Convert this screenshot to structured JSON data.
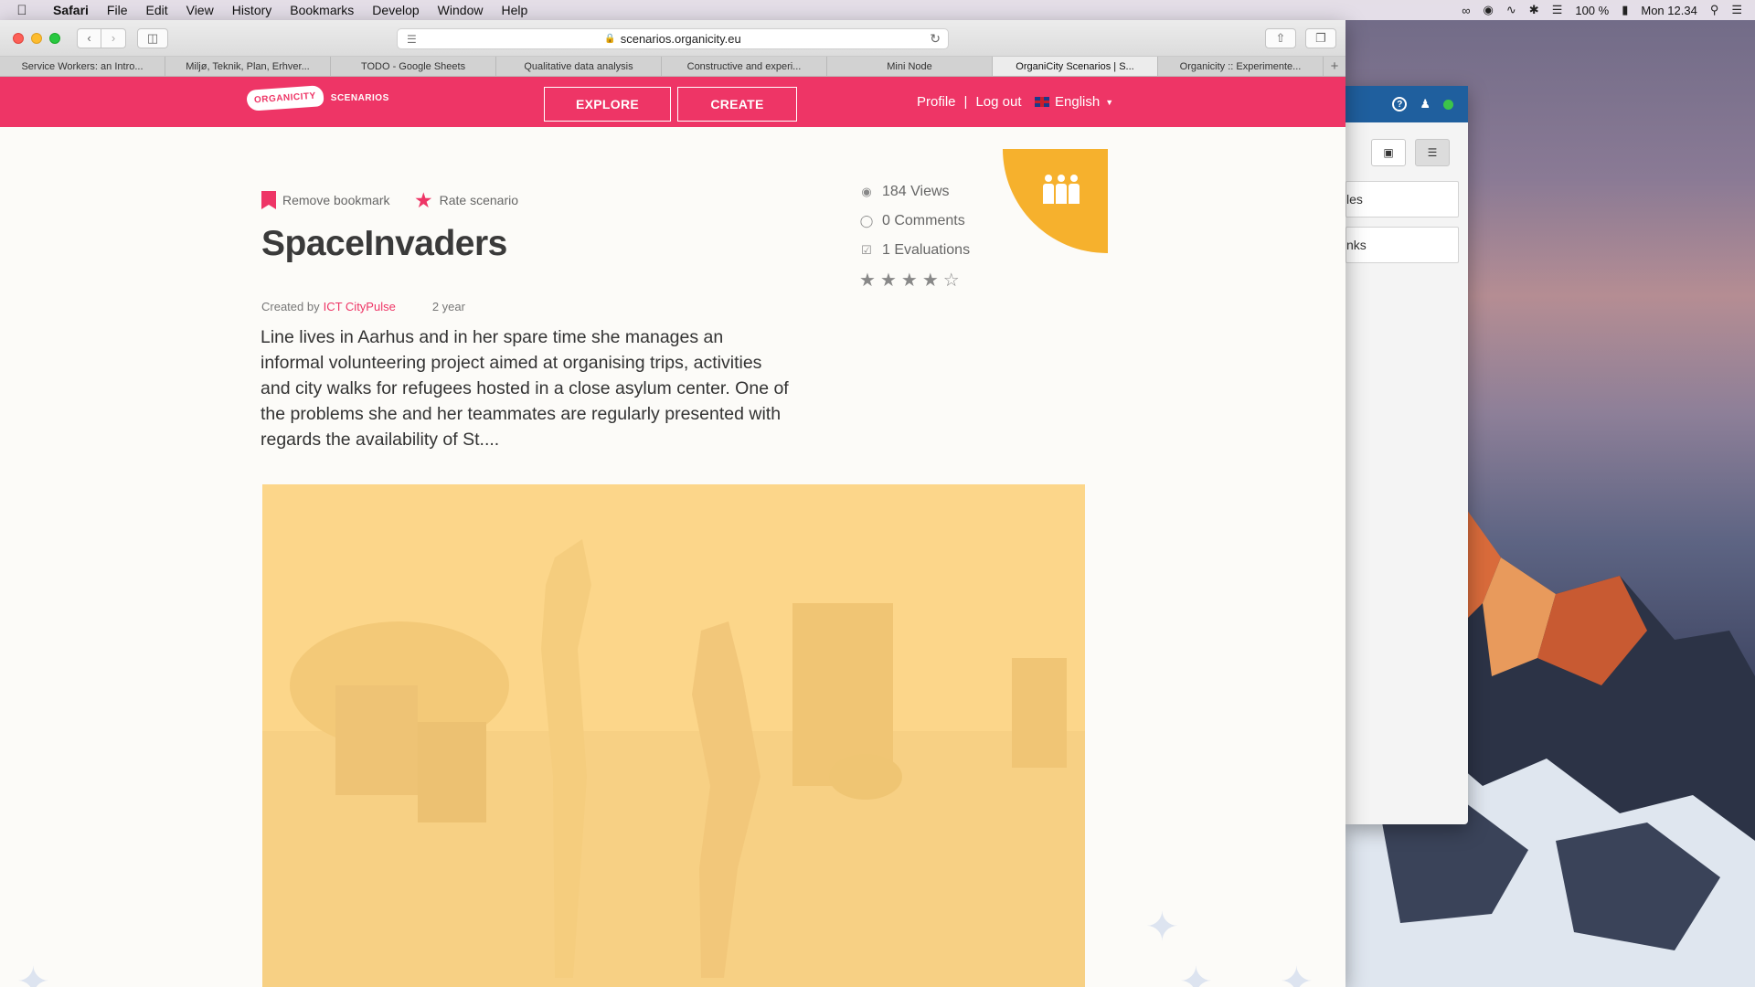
{
  "menubar": {
    "app": "Safari",
    "items": [
      "File",
      "Edit",
      "View",
      "History",
      "Bookmarks",
      "Develop",
      "Window",
      "Help"
    ],
    "battery": "100 %",
    "clock": "Mon 12.34"
  },
  "browser": {
    "url": "scenarios.organicity.eu",
    "tabs": [
      "Service Workers: an Intro...",
      "Miljø, Teknik, Plan, Erhver...",
      "TODO - Google Sheets",
      "Qualitative data analysis",
      "Constructive and experi...",
      "Mini Node",
      "OrganiCity Scenarios | S...",
      "Organicity :: Experimente..."
    ],
    "active_tab_index": 6
  },
  "site": {
    "logo_text": "ORGANICITY",
    "logo_sub": "SCENARIOS",
    "explore_label": "EXPLORE",
    "create_label": "CREATE",
    "profile_label": "Profile",
    "separator": "|",
    "logout_label": "Log out",
    "language": "English",
    "accent_color": "#ee3566",
    "badge_color": "#f6b12d"
  },
  "scenario": {
    "remove_bookmark_label": "Remove bookmark",
    "rate_label": "Rate scenario",
    "title": "SpaceInvaders",
    "created_by_label": "Created by",
    "author": "ICT CityPulse",
    "age": "2 year",
    "description": "Line lives in Aarhus and in her spare time she manages an informal volunteering project aimed at organising trips, activities and city walks for refugees hosted in a close asylum center. One of the problems she and her teammates are regularly presented with regards the availability of St....",
    "views": "184 Views",
    "comments": "0 Comments",
    "evaluations": "1 Evaluations",
    "rating_stars": 4,
    "rating_max": 5
  },
  "side_window": {
    "field1": "les",
    "field2": "nks"
  }
}
